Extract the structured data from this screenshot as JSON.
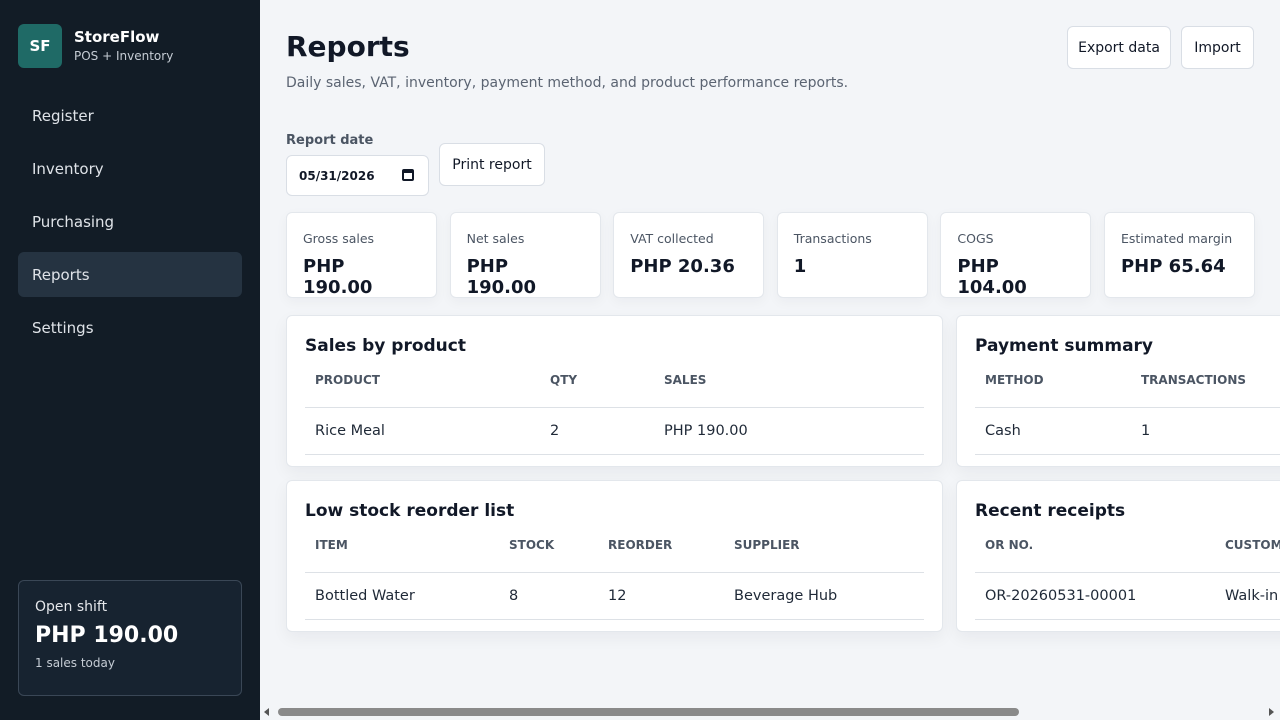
{
  "brand": {
    "logo": "SF",
    "name": "StoreFlow",
    "subtitle": "POS + Inventory"
  },
  "sidebar": {
    "items": [
      {
        "label": "Register",
        "active": false
      },
      {
        "label": "Inventory",
        "active": false
      },
      {
        "label": "Purchasing",
        "active": false
      },
      {
        "label": "Reports",
        "active": true
      },
      {
        "label": "Settings",
        "active": false
      }
    ],
    "shift": {
      "label": "Open shift",
      "amount": "PHP 190.00",
      "sub": "1 sales today"
    }
  },
  "header": {
    "title": "Reports",
    "subtitle": "Daily sales, VAT, inventory, payment method, and product performance reports.",
    "export_label": "Export data",
    "import_label": "Import"
  },
  "filters": {
    "date_label": "Report date",
    "date_value": "05/31/2026",
    "print_label": "Print report"
  },
  "stats": [
    {
      "label": "Gross sales",
      "value": "PHP 190.00"
    },
    {
      "label": "Net sales",
      "value": "PHP 190.00"
    },
    {
      "label": "VAT collected",
      "value": "PHP 20.36"
    },
    {
      "label": "Transactions",
      "value": "1"
    },
    {
      "label": "COGS",
      "value": "PHP 104.00"
    },
    {
      "label": "Estimated margin",
      "value": "PHP 65.64"
    }
  ],
  "sales_by_product": {
    "title": "Sales by product",
    "headers": [
      "PRODUCT",
      "QTY",
      "SALES"
    ],
    "rows": [
      [
        "Rice Meal",
        "2",
        "PHP 190.00"
      ]
    ]
  },
  "payment_summary": {
    "title": "Payment summary",
    "headers": [
      "METHOD",
      "TRANSACTIONS"
    ],
    "rows": [
      [
        "Cash",
        "1"
      ]
    ]
  },
  "low_stock": {
    "title": "Low stock reorder list",
    "headers": [
      "ITEM",
      "STOCK",
      "REORDER",
      "SUPPLIER"
    ],
    "rows": [
      [
        "Bottled Water",
        "8",
        "12",
        "Beverage Hub"
      ]
    ]
  },
  "recent_receipts": {
    "title": "Recent receipts",
    "headers": [
      "OR NO.",
      "CUSTOMER"
    ],
    "rows": [
      [
        "OR-20260531-00001",
        "Walk-in"
      ]
    ]
  }
}
